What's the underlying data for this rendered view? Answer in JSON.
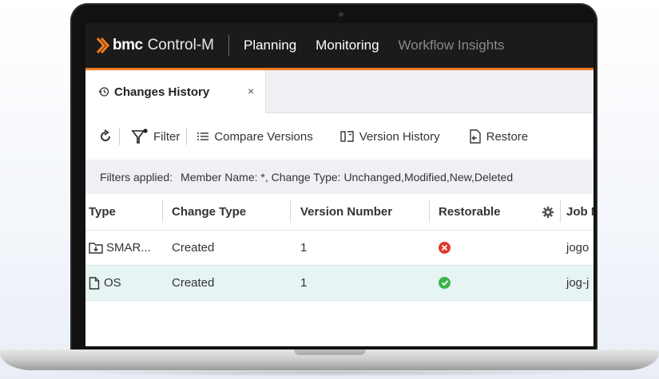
{
  "app": {
    "brand": "bmc",
    "product": "Control-M",
    "nav": [
      "Planning",
      "Monitoring",
      "Workflow Insights"
    ]
  },
  "tab": {
    "label": "Changes History",
    "close": "×"
  },
  "toolbar": {
    "filter": "Filter",
    "compare": "Compare Versions",
    "version_history": "Version History",
    "restore": "Restore"
  },
  "filters": {
    "label": "Filters applied:",
    "value": "Member Name: *, Change Type: Unchanged,Modified,New,Deleted"
  },
  "table": {
    "columns": {
      "type": "Type",
      "change_type": "Change Type",
      "version": "Version Number",
      "restorable": "Restorable",
      "job": "Job N"
    },
    "rows": [
      {
        "type": "SMAR...",
        "change_type": "Created",
        "version": "1",
        "restorable": "no",
        "job": "jogo"
      },
      {
        "type": "OS",
        "change_type": "Created",
        "version": "1",
        "restorable": "yes",
        "job": "jog-j"
      }
    ]
  },
  "colors": {
    "accent": "#f07c21",
    "nav_bg": "#1b1b1b",
    "selected_row": "#e6f4f3",
    "error": "#e0382b",
    "success": "#3bb54a"
  }
}
